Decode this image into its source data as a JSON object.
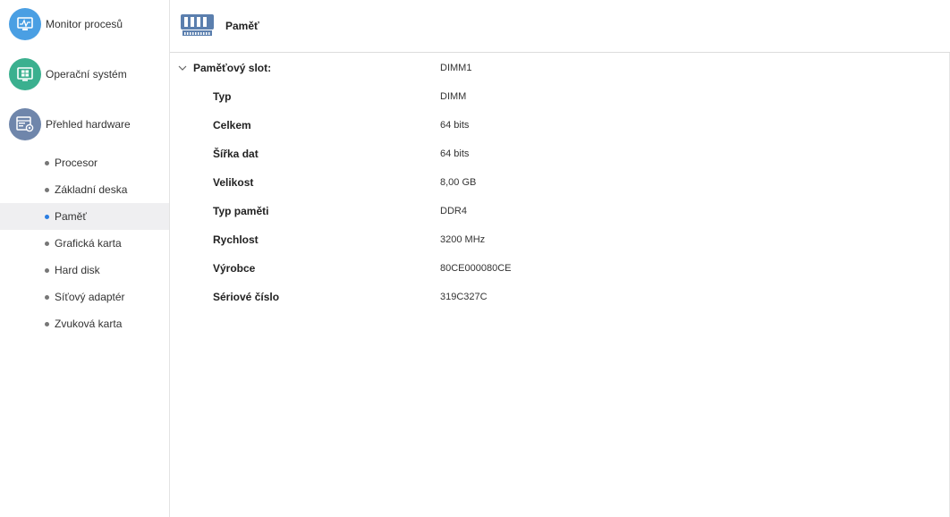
{
  "sidebar": {
    "main_items": [
      {
        "label": "Monitor procesů",
        "icon": "monitor-icon",
        "color": "#4a9fe3"
      },
      {
        "label": "Operační systém",
        "icon": "windows-icon",
        "color": "#3bb08f"
      },
      {
        "label": "Přehled hardware",
        "icon": "hardware-icon",
        "color": "#6f86ab"
      }
    ],
    "sub_items": [
      {
        "label": "Procesor"
      },
      {
        "label": "Základní deska"
      },
      {
        "label": "Paměť",
        "active": true
      },
      {
        "label": "Grafická karta"
      },
      {
        "label": "Hard disk"
      },
      {
        "label": "Síťový adaptér"
      },
      {
        "label": "Zvuková karta"
      }
    ]
  },
  "header": {
    "title": "Paměť",
    "icon": "memory-module-icon"
  },
  "details": {
    "group": {
      "label": "Paměťový slot:",
      "value": "DIMM1",
      "expanded": true
    },
    "rows": [
      {
        "label": "Typ",
        "value": "DIMM"
      },
      {
        "label": "Celkem",
        "value": "64 bits"
      },
      {
        "label": "Šířka dat",
        "value": "64 bits"
      },
      {
        "label": "Velikost",
        "value": "8,00 GB"
      },
      {
        "label": "Typ paměti",
        "value": "DDR4"
      },
      {
        "label": "Rychlost",
        "value": "3200 MHz"
      },
      {
        "label": "Výrobce",
        "value": "80CE000080CE"
      },
      {
        "label": "Sériové číslo",
        "value": "319C327C"
      }
    ]
  },
  "colors": {
    "accent": "#2a7de1",
    "active_bg": "#efeff1"
  }
}
